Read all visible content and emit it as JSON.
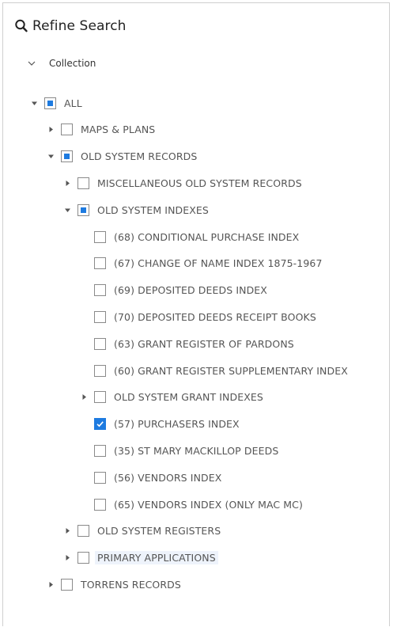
{
  "header": {
    "title": "Refine Search",
    "icon": "search-icon"
  },
  "section": {
    "label": "Collection",
    "icon": "chevron-down-icon"
  },
  "tree": [
    {
      "id": "all",
      "label": "ALL",
      "level": 0,
      "expander": "expanded",
      "state": "partial"
    },
    {
      "id": "maps-plans",
      "label": "MAPS & PLANS",
      "level": 1,
      "expander": "collapsed",
      "state": "unchecked"
    },
    {
      "id": "old-system-records",
      "label": "OLD SYSTEM RECORDS",
      "level": 1,
      "expander": "expanded",
      "state": "partial"
    },
    {
      "id": "misc-old-system-records",
      "label": "MISCELLANEOUS OLD SYSTEM RECORDS",
      "level": 2,
      "expander": "collapsed",
      "state": "unchecked"
    },
    {
      "id": "old-system-indexes",
      "label": "OLD SYSTEM INDEXES",
      "level": 2,
      "expander": "expanded",
      "state": "partial"
    },
    {
      "id": "conditional-purchase-index",
      "label": "(68) CONDITIONAL PURCHASE INDEX",
      "level": 3,
      "expander": "none",
      "state": "unchecked"
    },
    {
      "id": "change-of-name-index",
      "label": "(67) CHANGE OF NAME INDEX 1875-1967",
      "level": 3,
      "expander": "none",
      "state": "unchecked"
    },
    {
      "id": "deposited-deeds-index",
      "label": "(69) DEPOSITED DEEDS INDEX",
      "level": 3,
      "expander": "none",
      "state": "unchecked"
    },
    {
      "id": "deposited-deeds-receipt-books",
      "label": "(70) DEPOSITED DEEDS RECEIPT BOOKS",
      "level": 3,
      "expander": "none",
      "state": "unchecked"
    },
    {
      "id": "grant-register-of-pardons",
      "label": "(63) GRANT REGISTER OF PARDONS",
      "level": 3,
      "expander": "none",
      "state": "unchecked"
    },
    {
      "id": "grant-register-supplementary-index",
      "label": "(60) GRANT REGISTER SUPPLEMENTARY INDEX",
      "level": 3,
      "expander": "none",
      "state": "unchecked"
    },
    {
      "id": "old-system-grant-indexes",
      "label": "OLD SYSTEM GRANT INDEXES",
      "level": 3,
      "expander": "collapsed",
      "state": "unchecked"
    },
    {
      "id": "purchasers-index",
      "label": "(57) PURCHASERS INDEX",
      "level": 3,
      "expander": "none",
      "state": "checked"
    },
    {
      "id": "st-mary-mackillop-deeds",
      "label": "(35) ST MARY MACKILLOP DEEDS",
      "level": 3,
      "expander": "none",
      "state": "unchecked"
    },
    {
      "id": "vendors-index",
      "label": "(56) VENDORS INDEX",
      "level": 3,
      "expander": "none",
      "state": "unchecked"
    },
    {
      "id": "vendors-index-only-mac-mc",
      "label": "(65) VENDORS INDEX (ONLY MAC MC)",
      "level": 3,
      "expander": "none",
      "state": "unchecked"
    },
    {
      "id": "old-system-registers",
      "label": "OLD SYSTEM REGISTERS",
      "level": 2,
      "expander": "collapsed",
      "state": "unchecked"
    },
    {
      "id": "primary-applications",
      "label": "PRIMARY APPLICATIONS",
      "level": 2,
      "expander": "collapsed",
      "state": "unchecked",
      "hovered": true
    },
    {
      "id": "torrens-records",
      "label": "TORRENS RECORDS",
      "level": 1,
      "expander": "collapsed",
      "state": "unchecked"
    }
  ],
  "colors": {
    "accent": "#1e7be0",
    "text": "#555555",
    "border": "#cfcfcf",
    "hover": "#eef3fb"
  }
}
